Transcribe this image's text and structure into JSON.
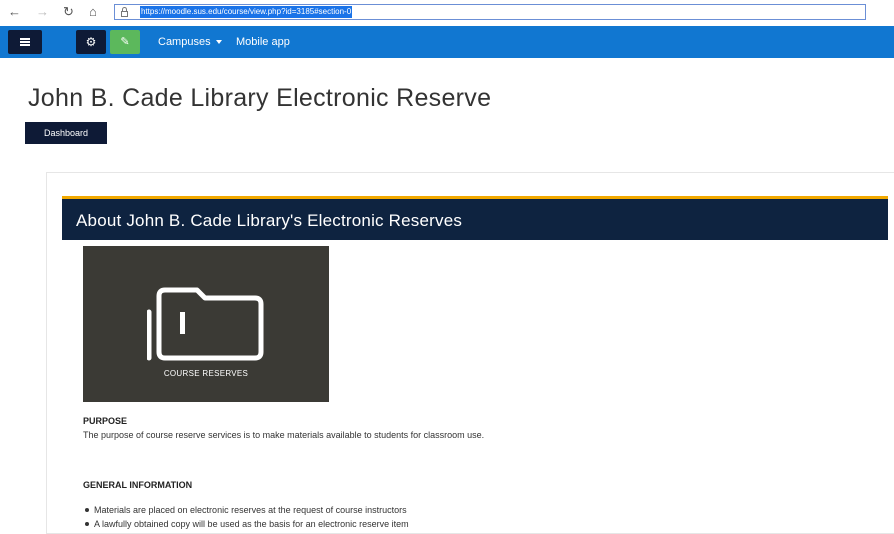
{
  "browser": {
    "url": "https://moodle.sus.edu/course/view.php?id=3185#section-0"
  },
  "navbar": {
    "links": [
      "Campuses",
      "Mobile app"
    ]
  },
  "page": {
    "title": "John B. Cade Library Electronic Reserve",
    "dashboard_label": "Dashboard"
  },
  "section": {
    "title": "About John B. Cade Library's Electronic Reserves",
    "image_caption": "COURSE RESERVES",
    "purpose_heading": "PURPOSE",
    "purpose_text": "The purpose of course reserve services is to make materials available to students for classroom use.",
    "general_heading": "GENERAL INFORMATION",
    "bullets": [
      "Materials are placed on electronic reserves at the request of course instructors",
      "A lawfully obtained copy will be used as the basis for an electronic reserve item"
    ]
  },
  "colors": {
    "navbar": "#1177d1",
    "dark_navy": "#0e1a36",
    "edit_green": "#5cb85c",
    "section_accent": "#f2a900"
  },
  "icons": [
    "back-arrow-icon",
    "forward-arrow-icon",
    "reload-icon",
    "home-icon",
    "lock-icon",
    "hamburger-icon",
    "gear-icon",
    "edit-icon",
    "folder-icon"
  ]
}
